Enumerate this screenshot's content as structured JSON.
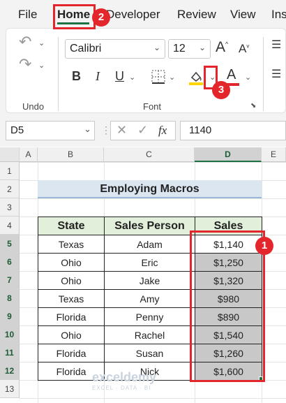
{
  "menu": {
    "file": "File",
    "home": "Home",
    "developer": "Developer",
    "review": "Review",
    "view": "View",
    "insert_partial": "Ins"
  },
  "ribbon": {
    "undo_label": "Undo",
    "font_label": "Font",
    "font_name": "Calibri",
    "font_size": "12",
    "bold": "B",
    "italic": "I",
    "underline": "U",
    "font_color_letter": "A",
    "increase_font": "A",
    "decrease_font": "A"
  },
  "formula_bar": {
    "cell_ref": "D5",
    "fx": "fx",
    "value": "1140"
  },
  "columns": [
    "A",
    "B",
    "C",
    "D",
    "E"
  ],
  "rows": [
    "1",
    "2",
    "3",
    "4",
    "5",
    "6",
    "7",
    "8",
    "9",
    "10",
    "11",
    "12",
    "13"
  ],
  "sheet": {
    "title": "Employing Macros",
    "headers": {
      "state": "State",
      "person": "Sales Person",
      "sales": "Sales"
    },
    "data": [
      {
        "state": "Texas",
        "person": "Adam",
        "sales": "$1,140"
      },
      {
        "state": "Ohio",
        "person": "Eric",
        "sales": "$1,250"
      },
      {
        "state": "Ohio",
        "person": "Jake",
        "sales": "$1,320"
      },
      {
        "state": "Texas",
        "person": "Amy",
        "sales": "$980"
      },
      {
        "state": "Florida",
        "person": "Penny",
        "sales": "$890"
      },
      {
        "state": "Ohio",
        "person": "Rachel",
        "sales": "$1,540"
      },
      {
        "state": "Florida",
        "person": "Susan",
        "sales": "$1,260"
      },
      {
        "state": "Florida",
        "person": "Nick",
        "sales": "$1,600"
      }
    ]
  },
  "badges": {
    "one": "1",
    "two": "2",
    "three": "3"
  },
  "watermark": {
    "name": "exceldemy",
    "tagline": "EXCEL · DATA · BI"
  },
  "colors": {
    "accent": "#1e7145",
    "highlight": "#e3262b",
    "title_fill": "#dce6f1",
    "header_fill": "#e2efda",
    "fill_yellow": "#ffd500",
    "font_red": "#e3262b"
  }
}
